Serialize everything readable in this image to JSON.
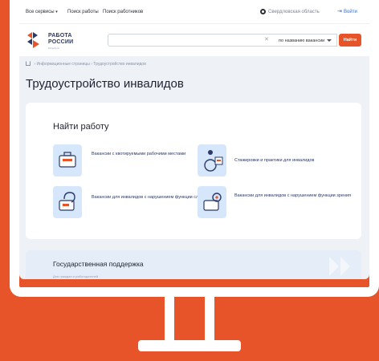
{
  "topbar": {
    "all_services": "Все сервисы",
    "job_search": "Поиск работы",
    "worker_search": "Поиск работников",
    "region": "Свердловская область",
    "login": "Войти"
  },
  "header": {
    "logo_line1": "РАБОТА",
    "logo_line2": "РОССИИ",
    "logo_sub": "Госуслуги",
    "search_value": "",
    "search_mode": "по названию вакансии",
    "find_label": "Найти"
  },
  "breadcrumb": {
    "item1": "Информационные страницы",
    "item2": "Трудоустройство инвалидов"
  },
  "page_title": "Трудоустройство инвалидов",
  "find_job": {
    "title": "Найти работу",
    "tiles": [
      {
        "label": "Вакансии с квотируемыми рабочими местами",
        "icon": "briefcase-icon"
      },
      {
        "label": "Стажировки и практики для инвалидов",
        "icon": "wheelchair-icon"
      },
      {
        "label": "Вакансии для инвалидов с нарушением функции слуха",
        "icon": "ear-icon"
      },
      {
        "label": "Вакансии для инвалидов с нарушением функции зрения",
        "icon": "eye-icon"
      }
    ]
  },
  "support": {
    "title": "Государственная поддержка",
    "subtitle": "Для граждан и работодателей"
  },
  "colors": {
    "brand_orange": "#e8542a",
    "brand_navy": "#2b3a67",
    "link_blue": "#2f6fdf",
    "tile_bg": "#d6e6fb"
  }
}
